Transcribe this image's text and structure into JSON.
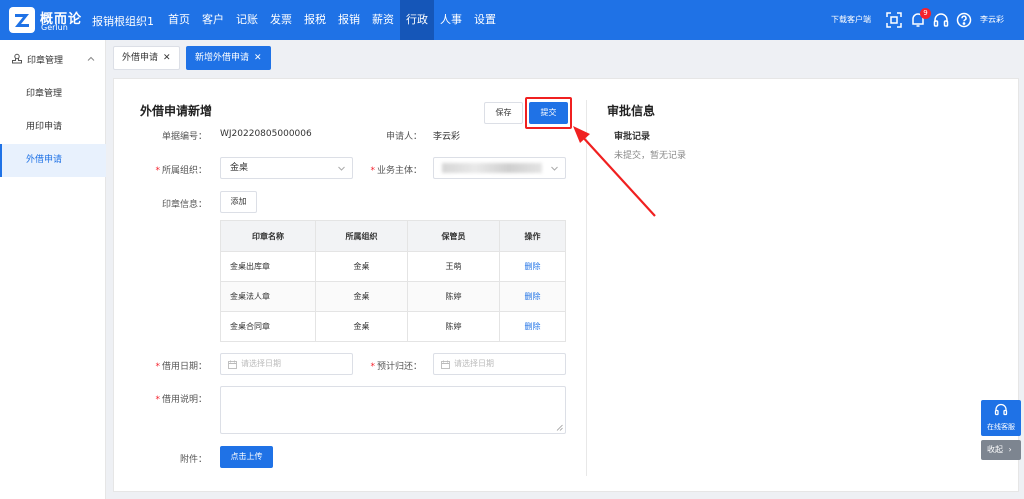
{
  "header": {
    "logo_cn": "概而论",
    "logo_en": "Gerlun",
    "org_name": "报销根组织1",
    "nav": [
      "首页",
      "客户",
      "记账",
      "发票",
      "报税",
      "报销",
      "薪资",
      "行政",
      "人事",
      "设置"
    ],
    "active_nav": "行政",
    "download_label": "下载客户端",
    "notification_count": "9",
    "user_name": "李云彩"
  },
  "sidebar": {
    "group_label": "印章管理",
    "items": [
      {
        "label": "印章管理"
      },
      {
        "label": "用印申请"
      },
      {
        "label": "外借申请"
      }
    ],
    "active_item": "外借申请"
  },
  "tabs": [
    {
      "label": "外借申请"
    },
    {
      "label": "新增外借申请"
    }
  ],
  "form": {
    "title": "外借申请新增",
    "save_label": "保存",
    "submit_label": "提交",
    "doc_no_label": "单据编号：",
    "doc_no_value": "WJ20220805000006",
    "applicant_label": "申请人：",
    "applicant_value": "李云彩",
    "org_label": "所属组织：",
    "org_value": "金桌",
    "entity_label": "业务主体：",
    "seal_info_label": "印章信息：",
    "add_label": "添加",
    "borrow_date_label": "借用日期：",
    "date_placeholder": "请选择日期",
    "return_date_label": "预计归还：",
    "return_date_placeholder": "请选择日期",
    "desc_label": "借用说明：",
    "attach_label": "附件：",
    "upload_label": "点击上传"
  },
  "table": {
    "headers": [
      "印章名称",
      "所属组织",
      "保管员",
      "操作"
    ],
    "rows": [
      {
        "name": "金桌出库章",
        "org": "金桌",
        "keeper": "王萌",
        "action": "删除"
      },
      {
        "name": "金桌法人章",
        "org": "金桌",
        "keeper": "陈婷",
        "action": "删除"
      },
      {
        "name": "金桌合同章",
        "org": "金桌",
        "keeper": "陈婷",
        "action": "删除"
      }
    ]
  },
  "approval": {
    "title": "审批信息",
    "record_title": "审批记录",
    "empty_text": "未提交，暂无记录"
  },
  "float": {
    "service_label": "在线客服",
    "collapse_label": "收起"
  },
  "colors": {
    "primary": "#1f72e6",
    "highlight": "#f02020",
    "required": "#f5222d"
  }
}
